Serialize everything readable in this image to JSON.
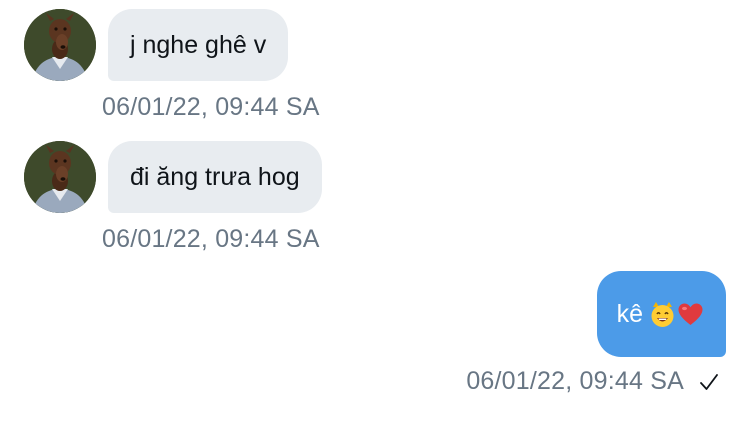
{
  "messages": [
    {
      "direction": "incoming",
      "text": "j nghe ghê v",
      "timestamp": "06/01/22, 09:44 SA",
      "avatar": "doberman-dog-avatar"
    },
    {
      "direction": "incoming",
      "text": "đi ăng trưa hog",
      "timestamp": "06/01/22, 09:44 SA",
      "avatar": "doberman-dog-avatar"
    },
    {
      "direction": "outgoing",
      "text": "kê",
      "emojis": [
        "grinning-cat-emoji",
        "red-heart-emoji"
      ],
      "timestamp": "06/01/22, 09:44 SA",
      "status_icon": "checkmark-icon"
    }
  ],
  "colors": {
    "incoming_bubble": "#e8ecf0",
    "outgoing_bubble": "#4c9be8",
    "timestamp": "#687684",
    "text": "#0f1419"
  }
}
